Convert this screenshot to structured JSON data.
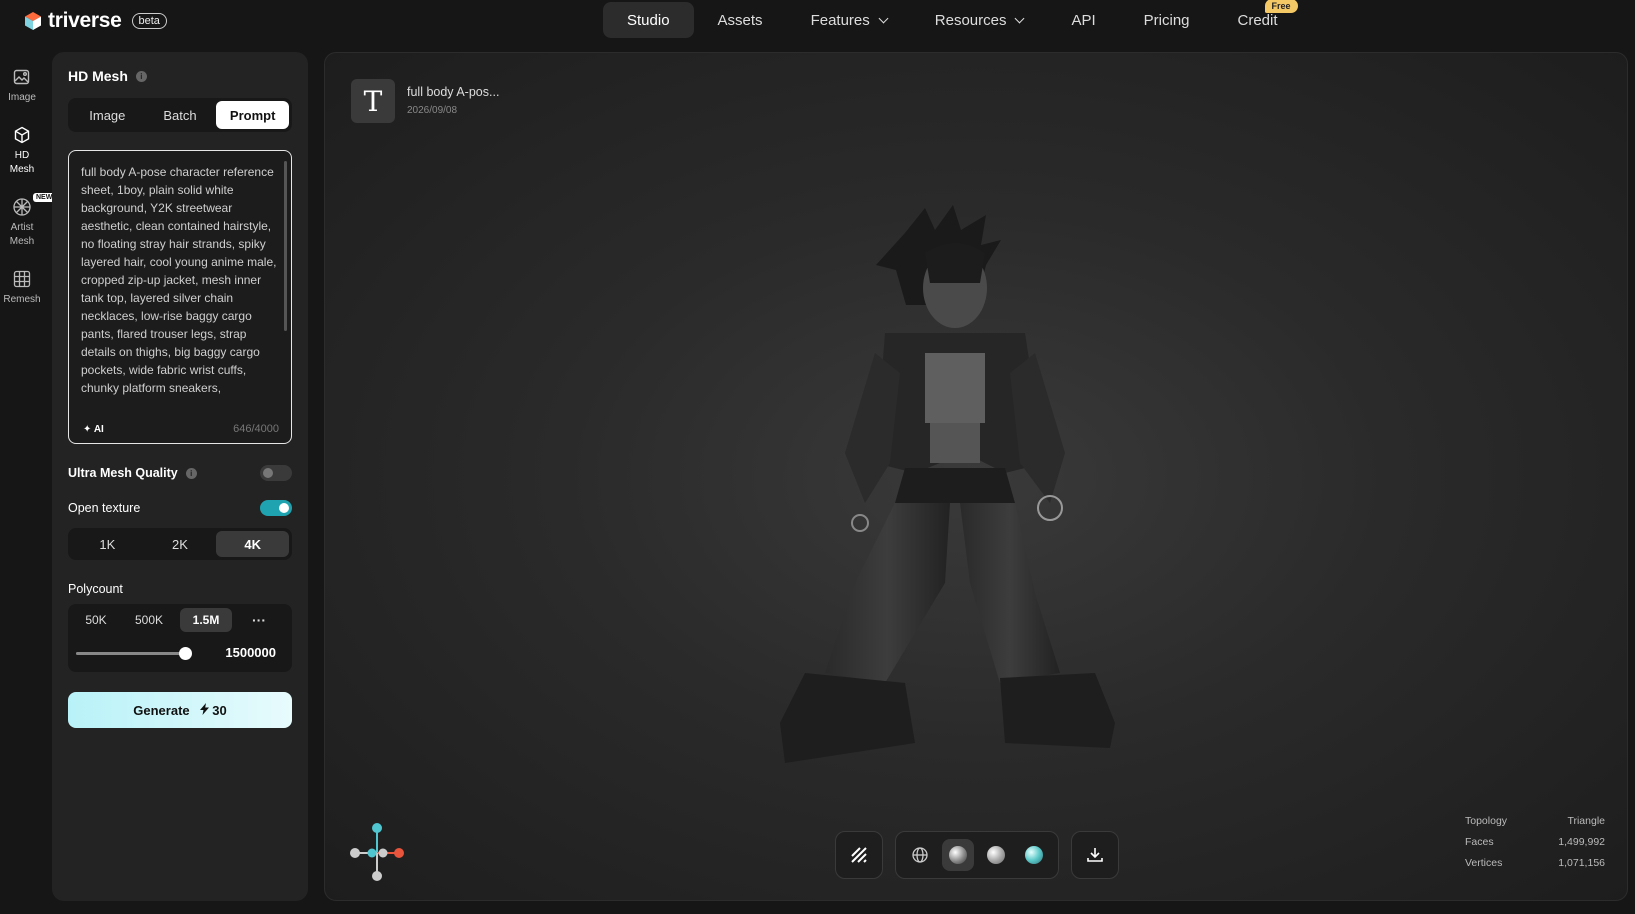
{
  "app": {
    "name": "triverse",
    "badge": "beta"
  },
  "nav": {
    "items": [
      {
        "label": "Studio",
        "active": true
      },
      {
        "label": "Assets"
      },
      {
        "label": "Features",
        "dropdown": true
      },
      {
        "label": "Resources",
        "dropdown": true
      },
      {
        "label": "API"
      },
      {
        "label": "Pricing"
      },
      {
        "label": "Credit",
        "badge": "Free"
      }
    ]
  },
  "rail": {
    "items": [
      {
        "label": "Image",
        "icon": "image-icon"
      },
      {
        "label": "HD Mesh",
        "icon": "cube-icon",
        "active": true
      },
      {
        "label": "Artist Mesh",
        "icon": "mesh-ball-icon",
        "badge": "NEW"
      },
      {
        "label": "Remesh",
        "icon": "grid-icon"
      }
    ]
  },
  "panel": {
    "title": "HD Mesh",
    "modes": [
      "Image",
      "Batch",
      "Prompt"
    ],
    "active_mode": "Prompt",
    "prompt": {
      "text": "full body A-pose character reference sheet, 1boy, plain solid white background, Y2K streetwear aesthetic, clean contained hairstyle, no floating stray hair strands, spiky layered hair, cool young anime male, cropped zip-up jacket, mesh inner tank top, layered silver chain necklaces, low-rise baggy cargo pants, flared trouser legs, strap details on thighs, big baggy cargo pockets, wide fabric wrist cuffs, chunky platform sneakers,",
      "ai_label": "AI",
      "counter": "646/4000"
    },
    "ultra_mesh": {
      "label": "Ultra Mesh Quality",
      "enabled": false
    },
    "open_texture": {
      "label": "Open texture",
      "enabled": true
    },
    "texture_res": {
      "options": [
        "1K",
        "2K",
        "4K"
      ],
      "active": "4K"
    },
    "polycount": {
      "label": "Polycount",
      "options": [
        "50K",
        "500K",
        "1.5M"
      ],
      "active": "1.5M",
      "more": "···",
      "value": "1500000",
      "slider_fraction": 0.96
    },
    "generate": {
      "label": "Generate",
      "cost": "30"
    }
  },
  "viewport": {
    "asset": {
      "icon": "T",
      "name": "full body A-pos...",
      "date": "2026/09/08"
    },
    "stats": [
      {
        "label": "Topology",
        "value": "Triangle"
      },
      {
        "label": "Faces",
        "value": "1,499,992"
      },
      {
        "label": "Vertices",
        "value": "1,071,156"
      }
    ]
  },
  "colors": {
    "accent": "#1fa3b0",
    "generate_start": "#b8f2f8",
    "free_badge": "#f5c866"
  }
}
